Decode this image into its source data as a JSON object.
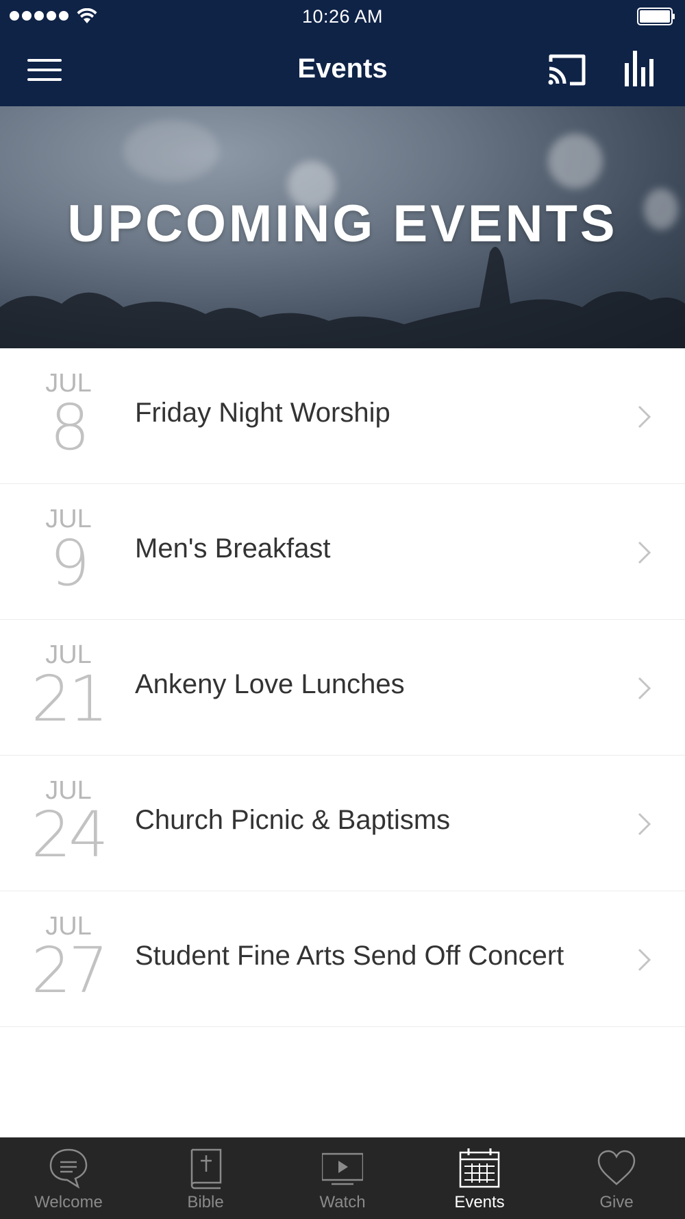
{
  "status_bar": {
    "time": "10:26 AM"
  },
  "nav": {
    "title": "Events"
  },
  "banner": {
    "title": "UPCOMING EVENTS"
  },
  "events": [
    {
      "month": "JUL",
      "day": "8",
      "title": "Friday Night Worship"
    },
    {
      "month": "JUL",
      "day": "9",
      "title": "Men's Breakfast"
    },
    {
      "month": "JUL",
      "day": "21",
      "title": "Ankeny Love Lunches"
    },
    {
      "month": "JUL",
      "day": "24",
      "title": "Church Picnic & Baptisms"
    },
    {
      "month": "JUL",
      "day": "27",
      "title": "Student Fine Arts Send Off Concert"
    }
  ],
  "tabs": [
    {
      "label": "Welcome",
      "icon": "chat-bubble-icon"
    },
    {
      "label": "Bible",
      "icon": "bible-icon"
    },
    {
      "label": "Watch",
      "icon": "play-screen-icon"
    },
    {
      "label": "Events",
      "icon": "calendar-icon",
      "active": true
    },
    {
      "label": "Give",
      "icon": "heart-icon"
    }
  ],
  "colors": {
    "nav_background": "#0f2347",
    "tabbar_background": "#262626",
    "tab_inactive": "#8a8a8a",
    "tab_active": "#ffffff"
  }
}
